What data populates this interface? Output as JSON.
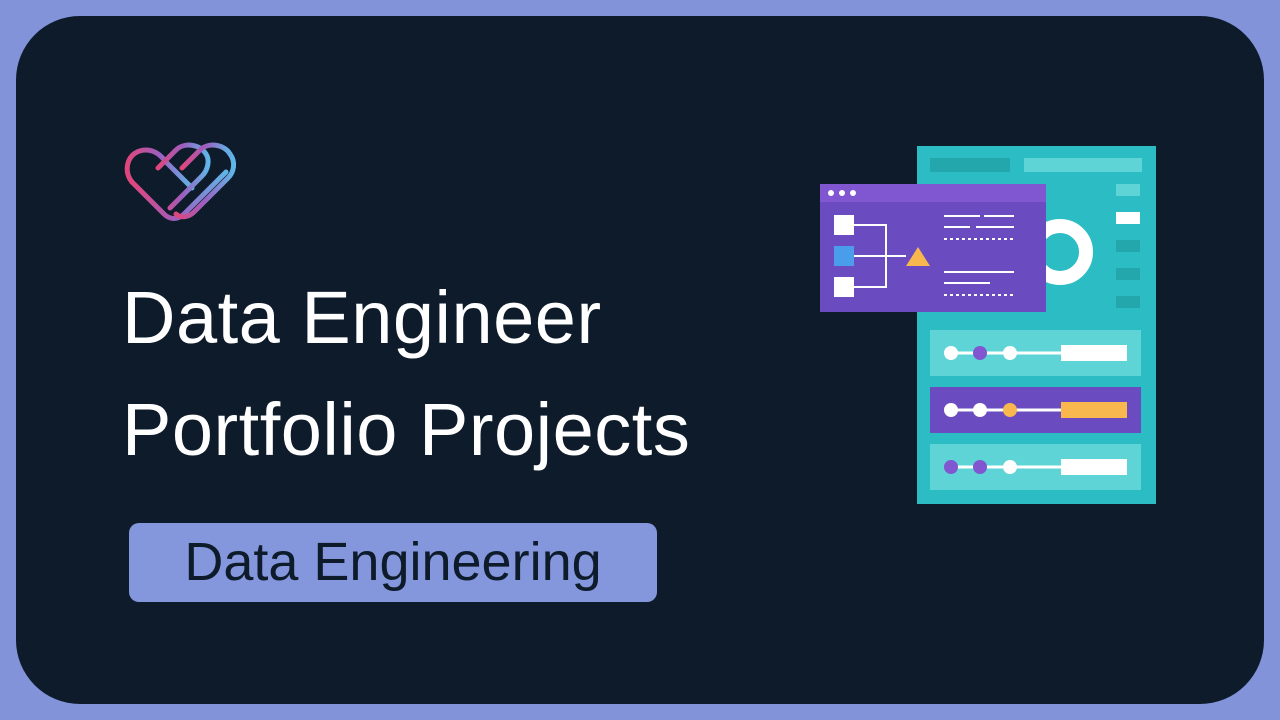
{
  "hero": {
    "title_line1": "Data Engineer",
    "title_line2": "Portfolio Projects",
    "category_badge": "Data Engineering"
  },
  "brand": {
    "logo_icon": "gradient-heart-logo-icon",
    "gradient_colors": [
      "#e0467c",
      "#9b5fc0",
      "#5fb6e8"
    ]
  },
  "illustration": {
    "icon": "data-dashboard-illustration",
    "colors": {
      "panel": "#2cbcc3",
      "panel_light": "#5fd4d6",
      "window": "#6a4bc0",
      "window_bar": "#8056d1",
      "accent": "#f8b84e",
      "node_blue": "#4a9de8"
    }
  },
  "colors": {
    "frame": "#8293da",
    "background": "#0e1b2b",
    "badge": "#8497dc",
    "title_text": "#ffffff"
  }
}
